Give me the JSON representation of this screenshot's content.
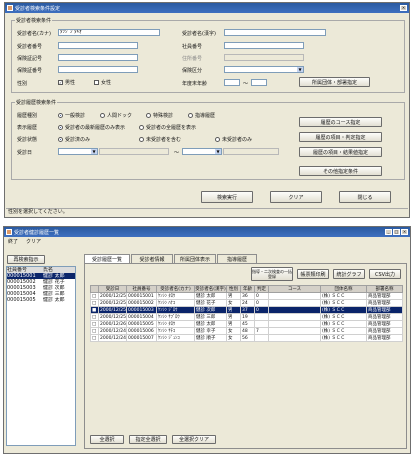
{
  "dialog": {
    "title": "受診者検索条件設定",
    "group_person": "受診者検索条件",
    "name_kana_label": "受診者名(カナ)",
    "name_kana_value": "ﾀﾂｼﾞﾝ ﾀｷｵ",
    "name_kanji_label": "受診者名(漢字)",
    "person_no_label": "受診者番号",
    "employee_no_label": "社員番号",
    "insurer_no_label": "保険証記号",
    "insurer_sym_label": "住所番号",
    "insurer_no2_label": "保険証番号",
    "insured_cat_label": "保険区分",
    "sex_label": "性別",
    "sex_male": "男性",
    "sex_female": "女性",
    "age_label": "年度末年齢",
    "age_sep": "～",
    "org_button": "所属団体・部署指定",
    "group_history": "受診履歴検索条件",
    "hist_type_label": "履歴種別",
    "hist_type_opts": [
      "一般検診",
      "人間ドック",
      "特殊検診",
      "指導履歴"
    ],
    "display_label": "表示履歴",
    "display_opts": [
      "受診者の最新履歴のみ表示",
      "受診者の全履歴を表示"
    ],
    "status_label": "受診状態",
    "status_opts": [
      "受診済のみ",
      "未受診者を含む",
      "未受診者のみ"
    ],
    "date_label": "受診日",
    "date_sep": "～",
    "course_button": "履歴のコース指定",
    "item_judge_button": "履歴の項目・判定指定",
    "item_result_button": "履歴の項目・結果値指定",
    "other_button": "その他指定条件",
    "search_button": "検索実行",
    "clear_button": "クリア",
    "close_button": "閉じる",
    "status_text": "性別を選択してください。"
  },
  "list_window": {
    "title": "受診者健診履歴一覧",
    "menu": [
      "終了",
      "クリア"
    ],
    "search_cond_button": "再検索指示",
    "left_headers": [
      "社員番号",
      "氏名"
    ],
    "left_rows": [
      [
        "000015001",
        "健診 太郎"
      ],
      [
        "000015002",
        "健診 花子"
      ],
      [
        "000015003",
        "健診 次郎"
      ],
      [
        "000015004",
        "健診 三郎"
      ],
      [
        "000015005",
        "健診 太郎"
      ]
    ],
    "tabs": [
      "受診履歴一覧",
      "受診者情報",
      "所属団体表示",
      "指導履歴"
    ],
    "right_buttons": [
      "指導・二次検査の一括登録",
      "帳票類印刷",
      "統計グラフ",
      "CSV出力"
    ],
    "grid_headers": [
      "",
      "受診日",
      "社員番号",
      "受診者名(カナ)",
      "受診者名(漢字)",
      "性別",
      "年齢",
      "判定",
      "コース",
      "団体名称",
      "部署名称"
    ],
    "grid_rows": [
      [
        "□",
        "2000/12/25",
        "000015001",
        "ｹﾝｼﾝ ﾀﾛｳ",
        "健診 太郎",
        "男",
        "36",
        "0",
        "",
        "(株) ＳＣＣ",
        "商品管理部"
      ],
      [
        "□",
        "2000/12/25",
        "000015002",
        "ｹﾝｼﾝ ﾊﾅｺ",
        "健診 花子",
        "女",
        "24",
        "0",
        "",
        "(株) ＳＣＣ",
        "商品管理部"
      ],
      [
        "■",
        "2000/12/25",
        "000015003",
        "ｹﾝｼﾝ ｼﾞﾛｳ",
        "健診 次郎",
        "男",
        "37",
        "0",
        "",
        "(株) ＳＣＣ",
        "商品管理部"
      ],
      [
        "□",
        "2000/12/25",
        "000015004",
        "ｹﾝｼﾝ ｻﾌﾞﾛｳ",
        "健診 三郎",
        "男",
        "19",
        "",
        "",
        "(株) ＳＣＣ",
        "商品管理部"
      ],
      [
        "□",
        "2000/12/26",
        "000015005",
        "ｹﾝｼﾝ ﾀﾛｳ",
        "健診 太郎",
        "男",
        "45",
        "",
        "",
        "(株) ＳＣＣ",
        "商品管理部"
      ],
      [
        "□",
        "2000/12/24",
        "000015006",
        "ｹﾝｼﾝ ｻﾁｺ",
        "健診 幸子",
        "女",
        "48",
        "7",
        "",
        "(株) ＳＣＣ",
        "商品管理部"
      ],
      [
        "□",
        "2000/12/24",
        "000015007",
        "ｹﾝｼﾝ ｼﾞｭﾝｺ",
        "健診 順子",
        "女",
        "56",
        "",
        "",
        "(株) ＳＣＣ",
        "商品管理部"
      ]
    ],
    "bottom_buttons": [
      "全選択",
      "指定全選択",
      "全選択クリア"
    ]
  }
}
